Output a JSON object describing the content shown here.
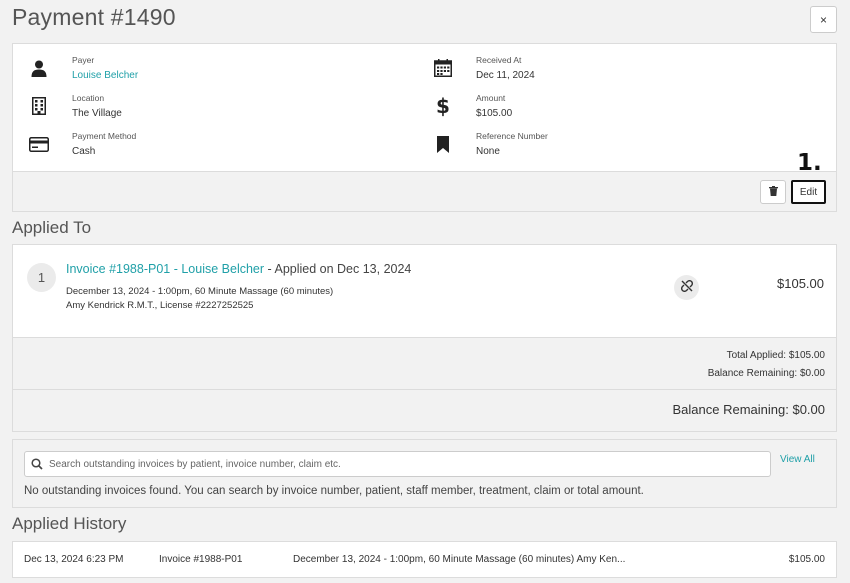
{
  "header": {
    "title": "Payment #1490",
    "close_label": "×"
  },
  "details": {
    "payer": {
      "label": "Payer",
      "value": "Louise Belcher",
      "icon": "person-icon"
    },
    "location": {
      "label": "Location",
      "value": "The Village",
      "icon": "building-icon"
    },
    "payment_method": {
      "label": "Payment Method",
      "value": "Cash",
      "icon": "credit-card-icon"
    },
    "received_at": {
      "label": "Received At",
      "value": "Dec 11, 2024",
      "icon": "calendar-icon"
    },
    "amount": {
      "label": "Amount",
      "value": "$105.00",
      "icon": "dollar-icon"
    },
    "reference_number": {
      "label": "Reference Number",
      "value": "None",
      "icon": "bookmark-icon"
    }
  },
  "actions": {
    "edit_label": "Edit",
    "step_marker": "1."
  },
  "applied_to": {
    "title": "Applied To",
    "items": [
      {
        "number": "1",
        "invoice_link": "Invoice #1988-P01",
        "separator": " - ",
        "patient_link": "Louise Belcher",
        "applied_text": " - Applied on Dec 13, 2024",
        "line1": "December 13, 2024 - 1:00pm, 60 Minute Massage (60 minutes)",
        "line2": "Amy Kendrick R.M.T., License #2227252525",
        "amount": "$105.00"
      }
    ],
    "total_applied": "Total Applied: $105.00",
    "balance_remaining_small": "Balance Remaining: $0.00",
    "balance_remaining_big": "Balance Remaining: $0.00"
  },
  "search": {
    "placeholder": "Search outstanding invoices by patient, invoice number, claim etc.",
    "view_all": "View All",
    "no_results": "No outstanding invoices found. You can search by invoice number, patient, staff member, treatment, claim or total amount."
  },
  "history": {
    "title": "Applied History",
    "rows": [
      {
        "date": "Dec 13, 2024 6:23 PM",
        "invoice": "Invoice #1988-P01",
        "description": "December 13, 2024 - 1:00pm, 60 Minute Massage (60 minutes) Amy Ken...",
        "amount": "$105.00"
      }
    ]
  },
  "colors": {
    "accent": "#20a0a8",
    "background": "#f2f2f2"
  }
}
